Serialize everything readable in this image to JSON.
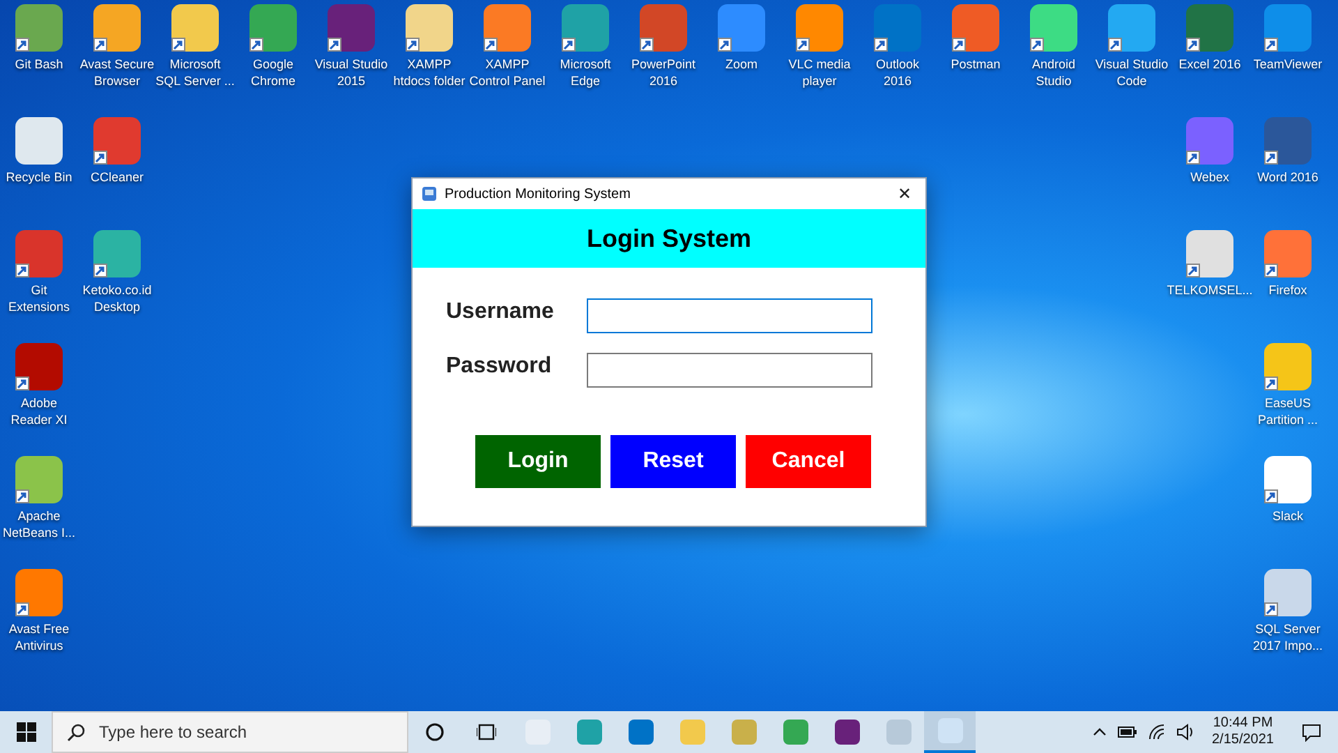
{
  "desktop_icons": [
    {
      "label": "Git Bash",
      "color": "#6aa84f",
      "shortcut": true
    },
    {
      "label": "Avast Secure\nBrowser",
      "color": "#f5a623",
      "shortcut": true
    },
    {
      "label": "Microsoft\nSQL Server ...",
      "color": "#f2c94c",
      "shortcut": true
    },
    {
      "label": "Google\nChrome",
      "color": "#34a853",
      "shortcut": true
    },
    {
      "label": "Visual Studio\n2015",
      "color": "#68217a",
      "shortcut": true
    },
    {
      "label": "XAMPP\nhtdocs folder",
      "color": "#f1d58a",
      "shortcut": true
    },
    {
      "label": "XAMPP\nControl Panel",
      "color": "#fb7a24",
      "shortcut": true
    },
    {
      "label": "Microsoft\nEdge",
      "color": "#1fa2a6",
      "shortcut": true
    },
    {
      "label": "PowerPoint\n2016",
      "color": "#d24726",
      "shortcut": true
    },
    {
      "label": "Zoom",
      "color": "#2d8cff",
      "shortcut": true
    },
    {
      "label": "VLC media\nplayer",
      "color": "#ff8800",
      "shortcut": true
    },
    {
      "label": "Outlook\n2016",
      "color": "#0072c6",
      "shortcut": true
    },
    {
      "label": "Postman",
      "color": "#ef5b25",
      "shortcut": true
    },
    {
      "label": "Android\nStudio",
      "color": "#3ddc84",
      "shortcut": true
    },
    {
      "label": "Visual Studio\nCode",
      "color": "#23a9f2",
      "shortcut": true
    },
    {
      "label": "Excel 2016",
      "color": "#217346",
      "shortcut": true
    },
    {
      "label": "TeamViewer",
      "color": "#0e8ee9",
      "shortcut": true
    },
    {
      "label": "Recycle Bin",
      "color": "#dfe8ee",
      "shortcut": false
    },
    {
      "label": "CCleaner",
      "color": "#e03a2f",
      "shortcut": true
    },
    {
      "label": "Git\nExtensions",
      "color": "#d9342b",
      "shortcut": true
    },
    {
      "label": "Ketoko.co.id\nDesktop",
      "color": "#2bb3a3",
      "shortcut": true
    },
    {
      "label": "Adobe\nReader XI",
      "color": "#b30b00",
      "shortcut": true
    },
    {
      "label": "Apache\nNetBeans I...",
      "color": "#8bc34a",
      "shortcut": true
    },
    {
      "label": "Avast Free\nAntivirus",
      "color": "#ff7800",
      "shortcut": true
    },
    {
      "label": "Webex",
      "color": "#7b61ff",
      "shortcut": true
    },
    {
      "label": "Word 2016",
      "color": "#2b579a",
      "shortcut": true
    },
    {
      "label": "TELKOMSEL...",
      "color": "#e0e0e0",
      "shortcut": true
    },
    {
      "label": "Firefox",
      "color": "#ff7139",
      "shortcut": true
    },
    {
      "label": "EaseUS\nPartition ...",
      "color": "#f5c518",
      "shortcut": true
    },
    {
      "label": "Slack",
      "color": "#ffffff",
      "shortcut": true
    },
    {
      "label": "SQL Server\n2017 Impo...",
      "color": "#c9d8ea",
      "shortcut": true
    }
  ],
  "dialog": {
    "title": "Production Monitoring System",
    "close": "✕",
    "header": "Login System",
    "fields": [
      {
        "label": "Username",
        "focused": true
      },
      {
        "label": "Password",
        "focused": false
      }
    ],
    "buttons": [
      {
        "label": "Login",
        "color": "#006400"
      },
      {
        "label": "Reset",
        "color": "#0000ff"
      },
      {
        "label": "Cancel",
        "color": "#ff0000"
      }
    ]
  },
  "taskbar": {
    "search_placeholder": "Type here to search",
    "apps": [
      {
        "kind": "cortana",
        "active": false
      },
      {
        "kind": "taskview",
        "active": false
      },
      {
        "kind": "app",
        "color": "#e8eef5",
        "active": false
      },
      {
        "kind": "app",
        "color": "#1fa2a6",
        "active": false
      },
      {
        "kind": "app",
        "color": "#0072c6",
        "active": false
      },
      {
        "kind": "app",
        "color": "#f2c94c",
        "active": false
      },
      {
        "kind": "app",
        "color": "#c9b04a",
        "active": false
      },
      {
        "kind": "app",
        "color": "#34a853",
        "active": false
      },
      {
        "kind": "app",
        "color": "#68217a",
        "active": false
      },
      {
        "kind": "app",
        "color": "#b7c9d9",
        "active": false
      },
      {
        "kind": "app",
        "color": "#cfe3f5",
        "active": true
      }
    ],
    "time": "10:44 PM",
    "date": "2/15/2021"
  }
}
